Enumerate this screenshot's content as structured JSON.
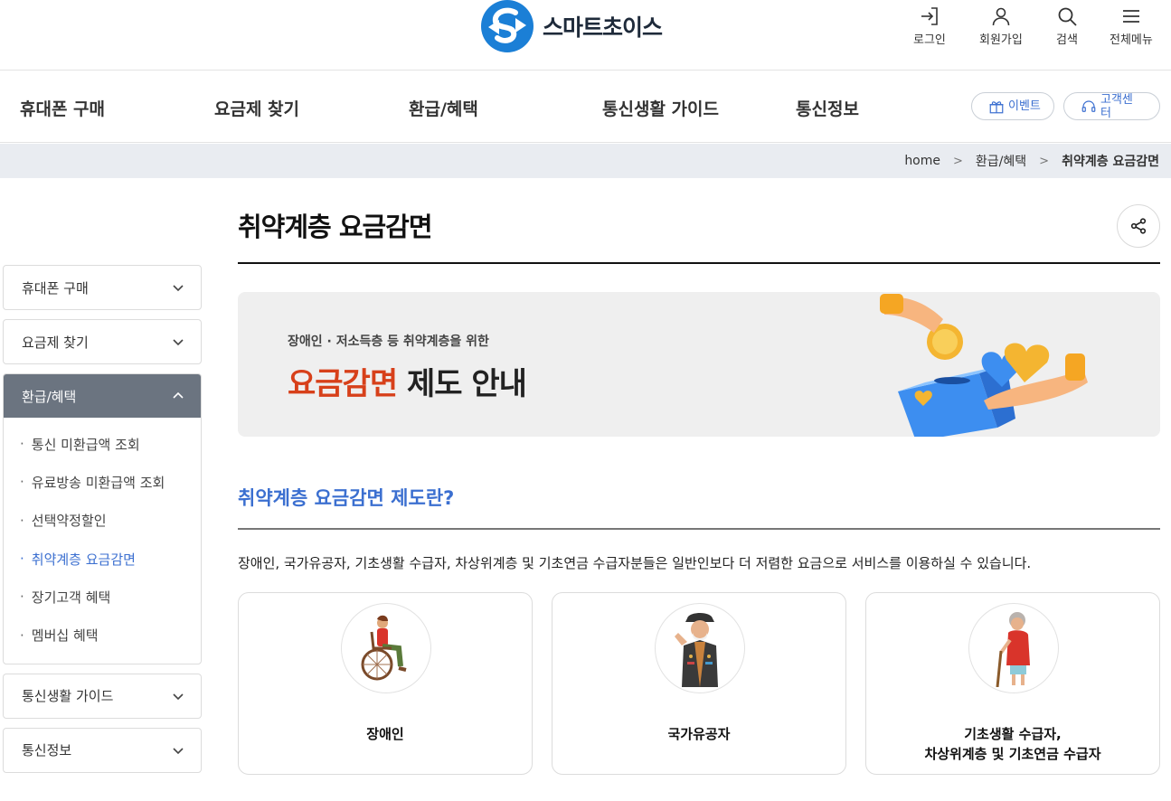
{
  "header": {
    "logo_text": "스마트초이스",
    "utils": [
      {
        "label": "로그인",
        "icon": "login-icon"
      },
      {
        "label": "회원가입",
        "icon": "user-icon"
      },
      {
        "label": "검색",
        "icon": "search-icon"
      },
      {
        "label": "전체메뉴",
        "icon": "menu-icon"
      }
    ]
  },
  "gnb": {
    "items": [
      "휴대폰 구매",
      "요금제 찾기",
      "환급/혜택",
      "통신생활 가이드",
      "통신정보"
    ],
    "event_label": "이벤트",
    "support_label": "고객센터"
  },
  "breadcrumb": {
    "home": "home",
    "level1": "환급/혜택",
    "current": "취약계층 요금감면"
  },
  "sidebar": {
    "top": [
      "휴대폰 구매",
      "요금제 찾기"
    ],
    "open_title": "환급/혜택",
    "sub_items": [
      "통신 미환급액 조회",
      "유료방송 미환급액 조회",
      "선택약정할인",
      "취약계층 요금감면",
      "장기고객 혜택",
      "멤버십 혜택"
    ],
    "active_sub": "취약계층 요금감면",
    "bottom": [
      "통신생활 가이드",
      "통신정보"
    ]
  },
  "main": {
    "title": "취약계층 요금감면",
    "banner": {
      "subtitle": "장애인 · 저소득층 등 취약계층을 위한",
      "highlight": "요금감면",
      "rest": " 제도 안내"
    },
    "section_title": "취약계층 요금감면 제도란?",
    "description": "장애인, 국가유공자, 기초생활 수급자, 차상위계층 및 기초연금 수급자분들은 일반인보다 더 저렴한 요금으로 서비스를 이용하실 수 있습니다.",
    "cards": [
      {
        "line1": "장애인",
        "line2": ""
      },
      {
        "line1": "국가유공자",
        "line2": ""
      },
      {
        "line1": "기초생활 수급자,",
        "line2": "차상위계층 및 기초연금 수급자"
      }
    ]
  },
  "colors": {
    "accent": "#3b6fd0",
    "highlight": "#d7401a",
    "sidebar_active": "#6b7480",
    "logo": "#1b7fd6"
  }
}
